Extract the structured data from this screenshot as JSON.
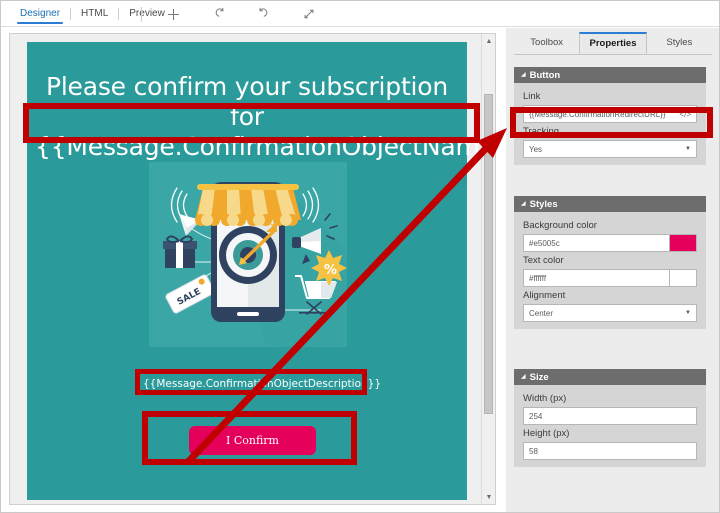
{
  "app": {
    "editor_tabs": [
      {
        "label": "Designer",
        "active": true
      },
      {
        "label": "HTML",
        "active": false
      },
      {
        "label": "Preview",
        "active": false
      }
    ],
    "toolbar_icons": [
      {
        "name": "plus-icon",
        "title": "Add"
      },
      {
        "name": "undo-icon",
        "title": "Undo"
      },
      {
        "name": "redo-icon",
        "title": "Redo"
      },
      {
        "name": "expand-icon",
        "title": "Expand"
      }
    ]
  },
  "canvas": {
    "background_color": "#2b9a9a",
    "illustration_background": "#3aa7a6",
    "heading_line1": "Please confirm your subscription for",
    "heading_line2": "{{Message.ConfirmationObjectName}}",
    "description": "{{Message.ConfirmationObjectDescription}}",
    "confirm_button_label": "I Confirm",
    "confirm_button_color": "#e5005c",
    "illustration_name": "mobile-marketing-illustration",
    "illustration_elements": [
      "smartphone",
      "shop-awning",
      "target-with-arrow",
      "gift-box",
      "sale-tag",
      "paper-plane",
      "megaphone",
      "shopping-cart",
      "percent-badge",
      "wifi-waves"
    ]
  },
  "scrollbar": {
    "up_arrow": "▲",
    "down_arrow": "▼"
  },
  "properties_panel": {
    "tabs": [
      {
        "label": "Toolbox",
        "active": false
      },
      {
        "label": "Properties",
        "active": true
      },
      {
        "label": "Styles",
        "active": false
      }
    ],
    "sections": [
      {
        "title": "Button",
        "caret": "◢",
        "fields": [
          {
            "label": "Link",
            "value": "{{Message.ConfirmationRedirectURL}}",
            "type": "text-with-code",
            "code_icon": "</>"
          },
          {
            "label": "Tracking",
            "value": "Yes",
            "type": "select",
            "arrow": "▼"
          }
        ]
      },
      {
        "title": "Styles",
        "caret": "◢",
        "fields": [
          {
            "label": "Background color",
            "value": "#e5005c",
            "type": "color",
            "swatch": "#e5005c"
          },
          {
            "label": "Text color",
            "value": "#ffffff",
            "type": "color",
            "swatch": "#ffffff"
          },
          {
            "label": "Alignment",
            "value": "Center",
            "type": "select",
            "arrow": "▼"
          }
        ]
      },
      {
        "title": "Size",
        "caret": "◢",
        "fields": [
          {
            "label": "Width (px)",
            "value": "254",
            "type": "text"
          },
          {
            "label": "Height (px)",
            "value": "58",
            "type": "text"
          }
        ]
      }
    ]
  },
  "annotations": {
    "highlight_color": "#c00000",
    "boxes": [
      "heading-placeholder",
      "description-placeholder",
      "confirm-button",
      "link-field"
    ],
    "arrow": "button-to-link-field-arrow"
  }
}
